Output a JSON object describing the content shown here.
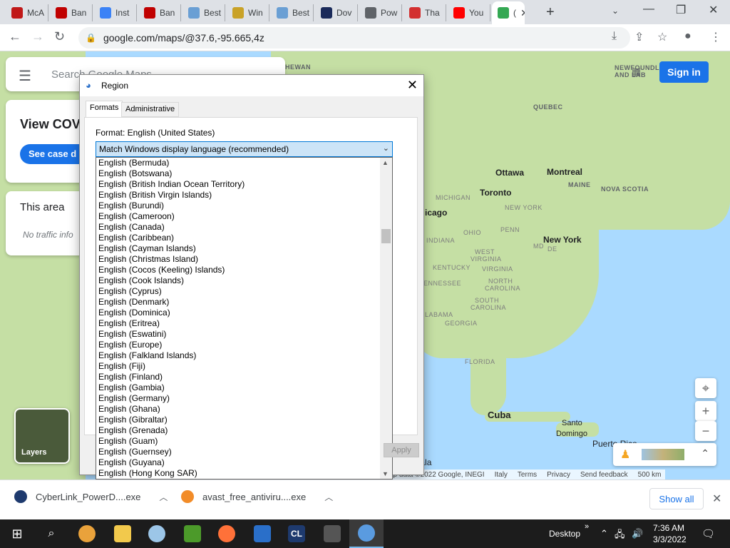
{
  "browser": {
    "tabs": [
      {
        "label": "McA",
        "icon": "mcafee-icon",
        "color": "#c01818"
      },
      {
        "label": "Ban",
        "icon": "record-icon",
        "color": "#c00000"
      },
      {
        "label": "Inst",
        "icon": "globe-icon",
        "color": "#3b82f6"
      },
      {
        "label": "Ban",
        "icon": "record-icon",
        "color": "#c00000"
      },
      {
        "label": "Best",
        "icon": "edge-icon",
        "color": "#6a9fd4"
      },
      {
        "label": "Win",
        "icon": "document-icon",
        "color": "#c9a227"
      },
      {
        "label": "Best",
        "icon": "edge-icon",
        "color": "#6a9fd4"
      },
      {
        "label": "Dov",
        "icon": "video-icon",
        "color": "#1a2a5a"
      },
      {
        "label": "Pow",
        "icon": "globe-icon",
        "color": "#5f6368"
      },
      {
        "label": "Tha",
        "icon": "c-icon",
        "color": "#d32f2f"
      },
      {
        "label": "You",
        "icon": "youtube-icon",
        "color": "#ff0000"
      },
      {
        "label": "(",
        "icon": "maps-icon",
        "color": "#34a853",
        "active": true
      }
    ],
    "url": "google.com/maps/@37.6,-95.665,4z"
  },
  "map": {
    "search_placeholder": "Search Google Maps",
    "covid_title": "View COVI",
    "covid_button": "See case d",
    "area_title": "This area",
    "area_text": "No traffic info",
    "sign_in": "Sign in",
    "layers": "Layers",
    "labels": {
      "hewan": "HEWAN",
      "quebec": "QUEBEC",
      "newfoundland": "NEWFOUNDL",
      "andlab": "AND LAB",
      "ottawa": "Ottawa",
      "montreal": "Montreal",
      "maine": "MAINE",
      "novascotia": "NOVA SCOTIA",
      "toronto": "Toronto",
      "michigan": "MICHIGAN",
      "newyorkstate": "NEW YORK",
      "chicago": "icago",
      "penn": "PENN",
      "ohio": "OHIO",
      "newyork": "New York",
      "indiana": "INDIANA",
      "md": "MD",
      "de": "DE",
      "westvirginia": "WEST",
      "virginia": "VIRGINIA",
      "kentucky": "KENTUCKY",
      "virginia2": "VIRGINIA",
      "ennessee": "ENNESSEE",
      "northcarolina": "NORTH",
      "carolina": "CAROLINA",
      "southcarolina": "SOUTH",
      "carolina2": "CAROLINA",
      "alabama": "LABAMA",
      "georgia": "GEORGIA",
      "florida": "FLORIDA",
      "cuba": "Cuba",
      "santo": "Santo",
      "domingo": "Domingo",
      "puerto": "Puerto Rico",
      "guatemala": "uatemala"
    },
    "footer": [
      "ap data ©2022 Google, INEGI",
      "Italy",
      "Terms",
      "Privacy",
      "Send feedback",
      "500 km"
    ]
  },
  "dialog": {
    "title": "Region",
    "tabs": [
      "Formats",
      "Administrative"
    ],
    "format_label": "Format: English (United States)",
    "combo_value": "Match Windows display language (recommended)",
    "apply": "Apply",
    "options": [
      "English (Bermuda)",
      "English (Botswana)",
      "English (British Indian Ocean Territory)",
      "English (British Virgin Islands)",
      "English (Burundi)",
      "English (Cameroon)",
      "English (Canada)",
      "English (Caribbean)",
      "English (Cayman Islands)",
      "English (Christmas Island)",
      "English (Cocos (Keeling) Islands)",
      "English (Cook Islands)",
      "English (Cyprus)",
      "English (Denmark)",
      "English (Dominica)",
      "English (Eritrea)",
      "English (Eswatini)",
      "English (Europe)",
      "English (Falkland Islands)",
      "English (Fiji)",
      "English (Finland)",
      "English (Gambia)",
      "English (Germany)",
      "English (Ghana)",
      "English (Gibraltar)",
      "English (Grenada)",
      "English (Guam)",
      "English (Guernsey)",
      "English (Guyana)",
      "English (Hong Kong SAR)"
    ]
  },
  "downloads": {
    "items": [
      {
        "name": "CyberLink_PowerD....exe",
        "color": "#1e3a6e"
      },
      {
        "name": "avast_free_antiviru....exe",
        "color": "#f28c28"
      }
    ],
    "show_all": "Show all"
  },
  "taskbar": {
    "desktop": "Desktop",
    "time": "7:36 AM",
    "date": "3/3/2022"
  }
}
